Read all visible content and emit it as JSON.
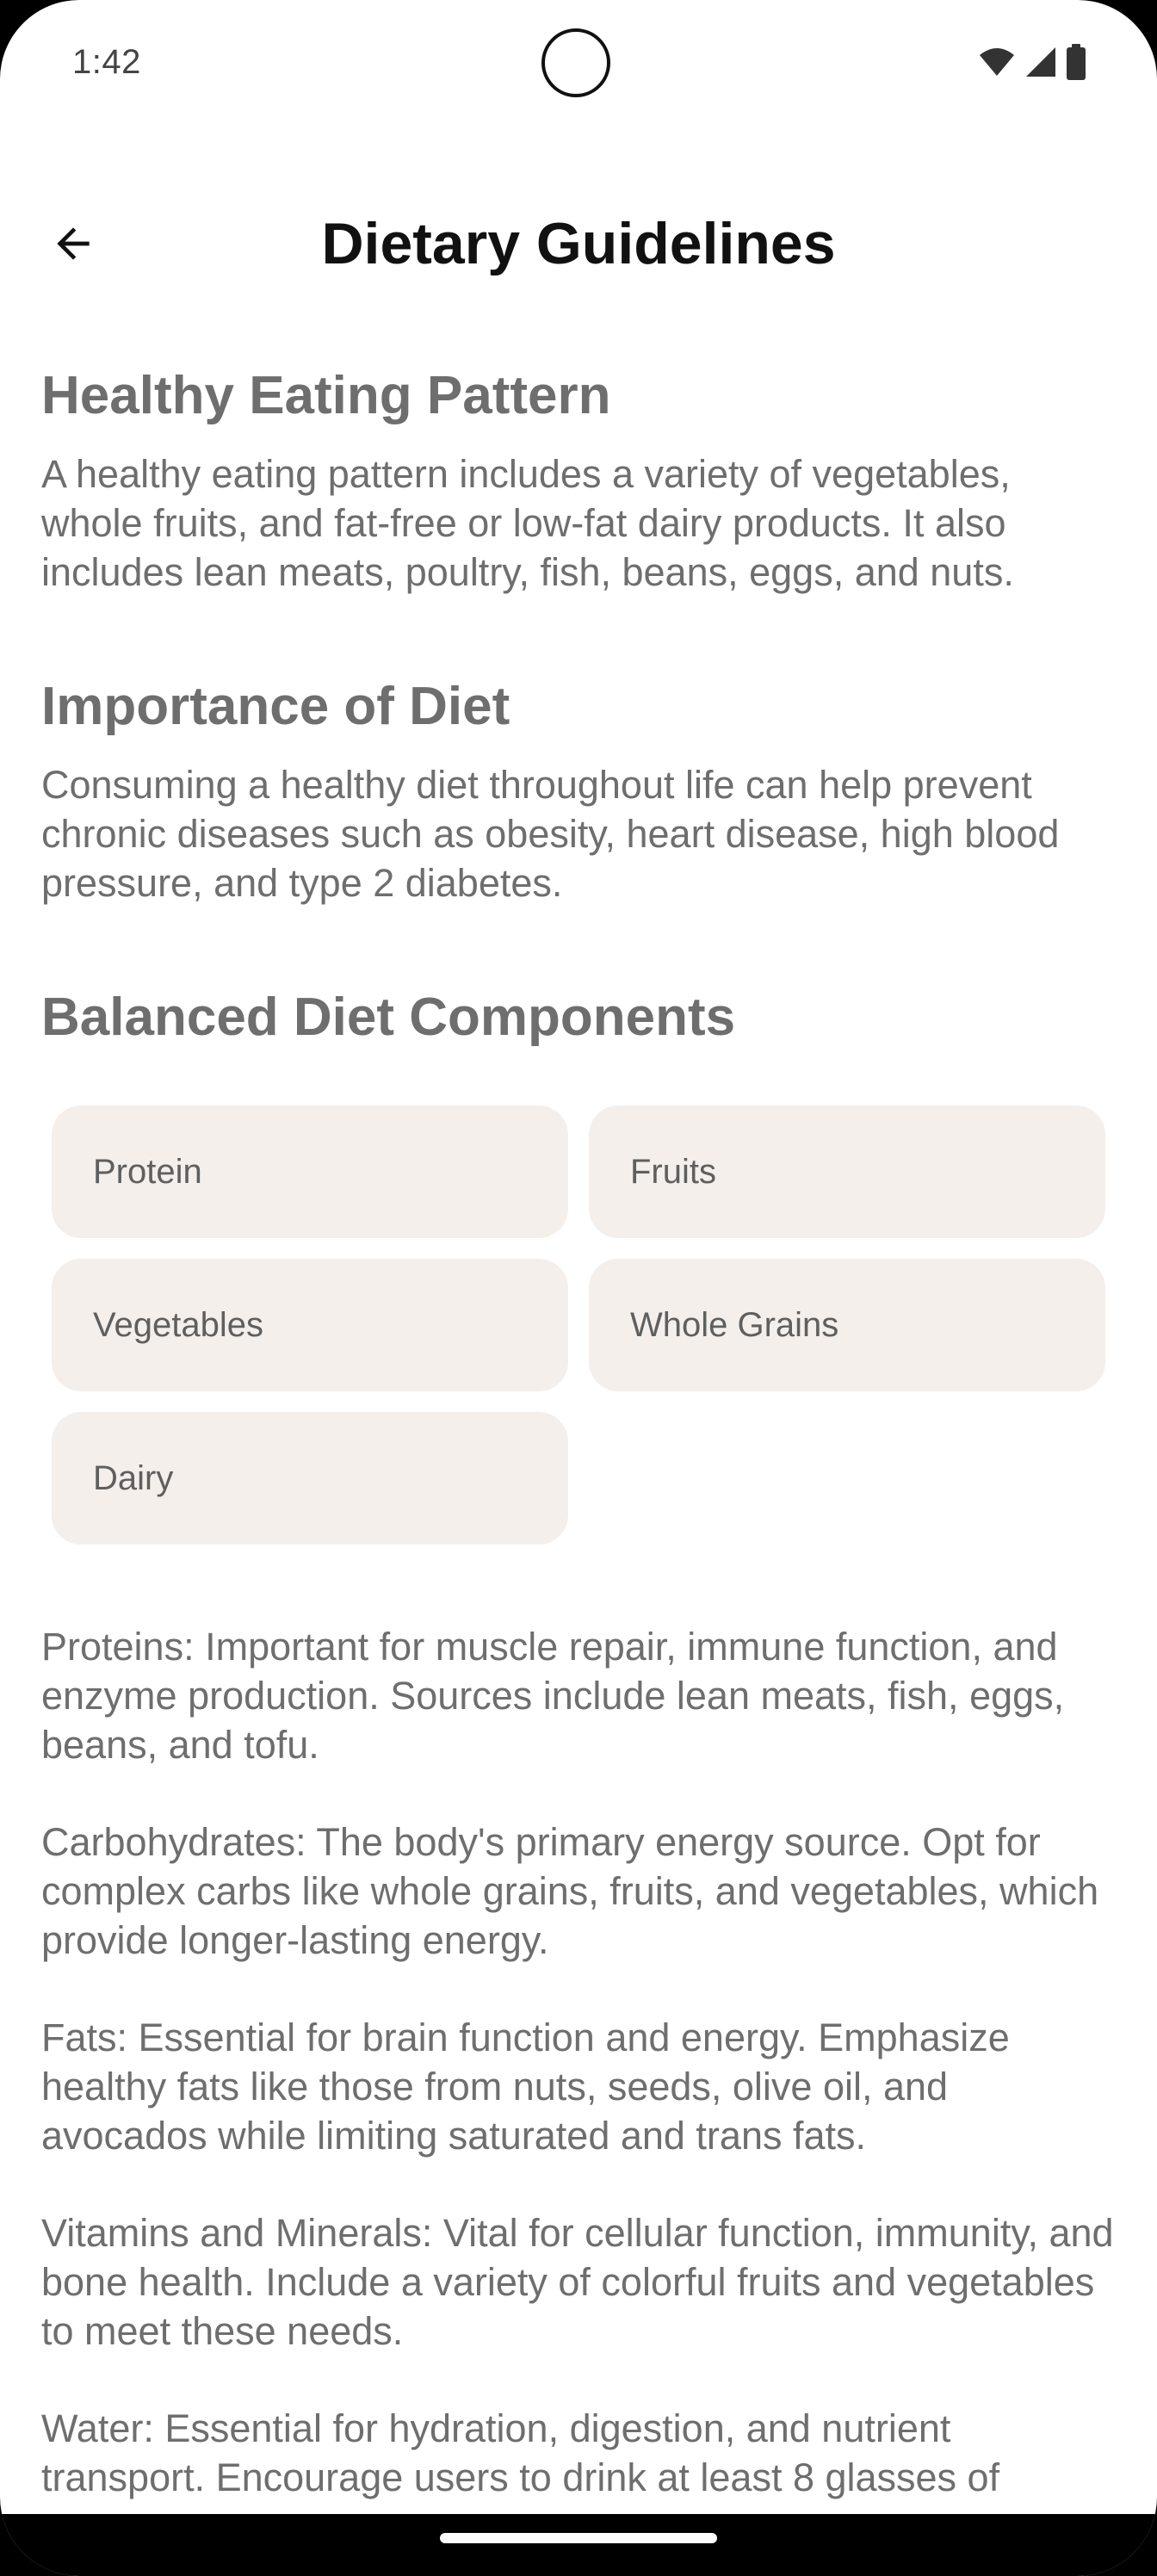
{
  "status_bar": {
    "time": "1:42",
    "icons": [
      "wifi-icon",
      "signal-icon",
      "battery-icon"
    ]
  },
  "app_bar": {
    "back_icon": "arrow-left-icon",
    "title": "Dietary Guidelines"
  },
  "sections": {
    "healthy_pattern": {
      "heading": "Healthy Eating Pattern",
      "body": "A healthy eating pattern includes a variety of vegetables, whole fruits, and fat-free or low-fat dairy products. It also includes lean meats, poultry, fish, beans, eggs, and nuts."
    },
    "importance": {
      "heading": "Importance of Diet",
      "body": "Consuming a healthy diet throughout life can help prevent chronic diseases such as obesity, heart disease, high blood pressure, and type 2 diabetes."
    },
    "components": {
      "heading": "Balanced Diet Components",
      "chips": [
        "Protein",
        "Fruits",
        "Vegetables",
        "Whole Grains",
        "Dairy"
      ]
    }
  },
  "details": [
    "Proteins: Important for muscle repair, immune function, and enzyme production. Sources include lean meats, fish, eggs, beans, and tofu.",
    "Carbohydrates: The body's primary energy source. Opt for complex carbs like whole grains, fruits, and vegetables, which provide longer-lasting energy.",
    "Fats: Essential for brain function and energy. Emphasize healthy fats like those from nuts, seeds, olive oil, and avocados while limiting saturated and trans fats.",
    "Vitamins and Minerals: Vital for cellular function, immunity, and bone health. Include a variety of colorful fruits and vegetables to meet these needs.",
    "Water: Essential for hydration, digestion, and nutrient transport. Encourage users to drink at least 8 glasses of"
  ],
  "colors": {
    "chip_background": "#f4efeb",
    "heading_text": "#6e6e6e",
    "title_text": "#111111"
  }
}
